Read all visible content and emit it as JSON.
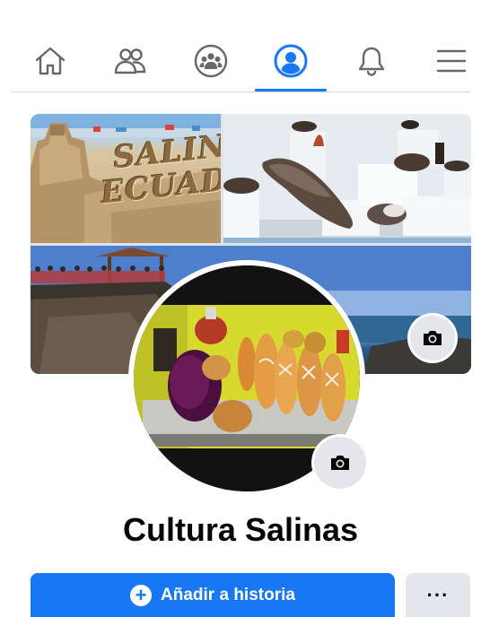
{
  "nav": {
    "items": [
      {
        "icon": "home-icon"
      },
      {
        "icon": "friends-icon"
      },
      {
        "icon": "groups-icon"
      },
      {
        "icon": "profile-icon",
        "active": true
      },
      {
        "icon": "notifications-icon"
      },
      {
        "icon": "menu-icon"
      }
    ],
    "active_color": "#1877f2",
    "icon_color": "#65676b"
  },
  "cover": {
    "sand_sign_line1": "SALINAS",
    "sand_sign_line2": "ECUADOR",
    "camera_icon": "camera-icon"
  },
  "profile": {
    "name": "Cultura Salinas",
    "avatar_camera_icon": "camera-icon"
  },
  "actions": {
    "add_story_label": "Añadir a historia",
    "add_story_icon": "plus-circle-icon",
    "more_label": "···"
  }
}
